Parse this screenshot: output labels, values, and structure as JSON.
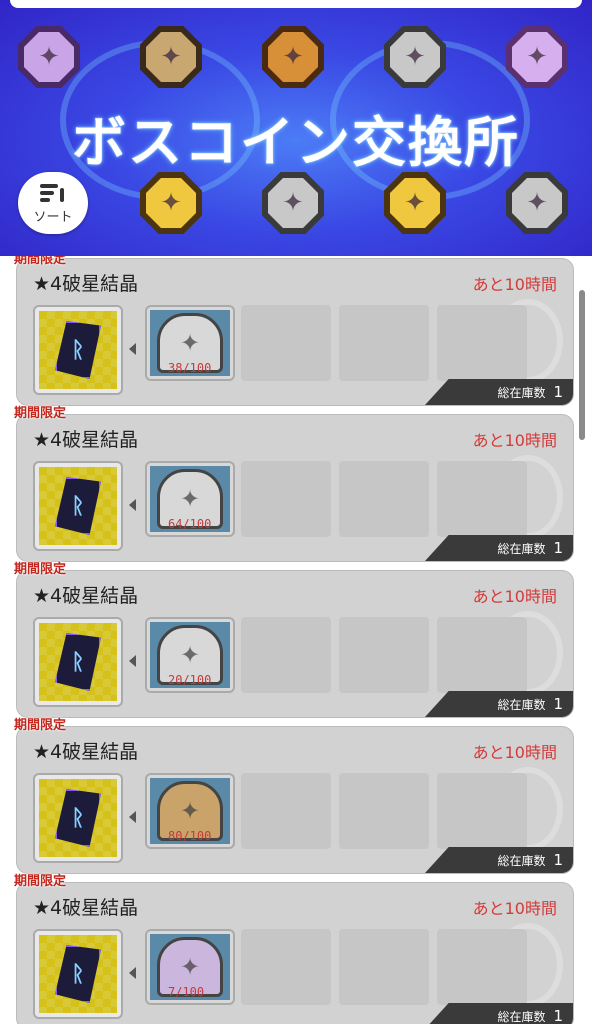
{
  "banner": {
    "title": "ボスコイン交換所",
    "sort_label": "ソート",
    "coins_top": [
      {
        "icon": "purple-boss-coin-icon",
        "variant": "purple",
        "glyph": "✦"
      },
      {
        "icon": "silver-boss-coin-icon",
        "variant": "bronze",
        "glyph": "✦"
      },
      {
        "icon": "copper-boss-coin-icon",
        "variant": "copper",
        "glyph": "✦"
      },
      {
        "icon": "silver-boss-coin-icon",
        "variant": "silver",
        "glyph": "✦"
      },
      {
        "icon": "violet-boss-coin-icon",
        "variant": "violet",
        "glyph": "✦"
      }
    ],
    "coins_bottom": [
      {
        "icon": "gold-boss-coin-icon",
        "variant": "gold",
        "glyph": "✦"
      },
      {
        "icon": "silver-boss-coin-icon",
        "variant": "silver",
        "glyph": "✦"
      },
      {
        "icon": "gold-boss-coin-icon",
        "variant": "gold",
        "glyph": "✦"
      },
      {
        "icon": "silver-boss-coin-icon",
        "variant": "silver",
        "glyph": "✦"
      }
    ]
  },
  "items": [
    {
      "tag": "期間限定",
      "name": "★4破星結晶",
      "timer": "あと10時間",
      "cost": "38/100",
      "stock_label": "総在庫数",
      "stock": "1",
      "coin_variant": "silver"
    },
    {
      "tag": "期間限定",
      "name": "★4破星結晶",
      "timer": "あと10時間",
      "cost": "64/100",
      "stock_label": "総在庫数",
      "stock": "1",
      "coin_variant": "silver"
    },
    {
      "tag": "期間限定",
      "name": "★4破星結晶",
      "timer": "あと10時間",
      "cost": "20/100",
      "stock_label": "総在庫数",
      "stock": "1",
      "coin_variant": "silver"
    },
    {
      "tag": "期間限定",
      "name": "★4破星結晶",
      "timer": "あと10時間",
      "cost": "80/100",
      "stock_label": "総在庫数",
      "stock": "1",
      "coin_variant": "bronze"
    },
    {
      "tag": "期間限定",
      "name": "★4破星結晶",
      "timer": "あと10時間",
      "cost": "7/100",
      "stock_label": "総在庫数",
      "stock": "1",
      "coin_variant": "purplec"
    }
  ],
  "colors": {
    "banner_bg": "#3a48e4",
    "timer_text": "#d43a3a",
    "limited_tag": "#c2261c",
    "card_bg": "#d2d2d2"
  }
}
